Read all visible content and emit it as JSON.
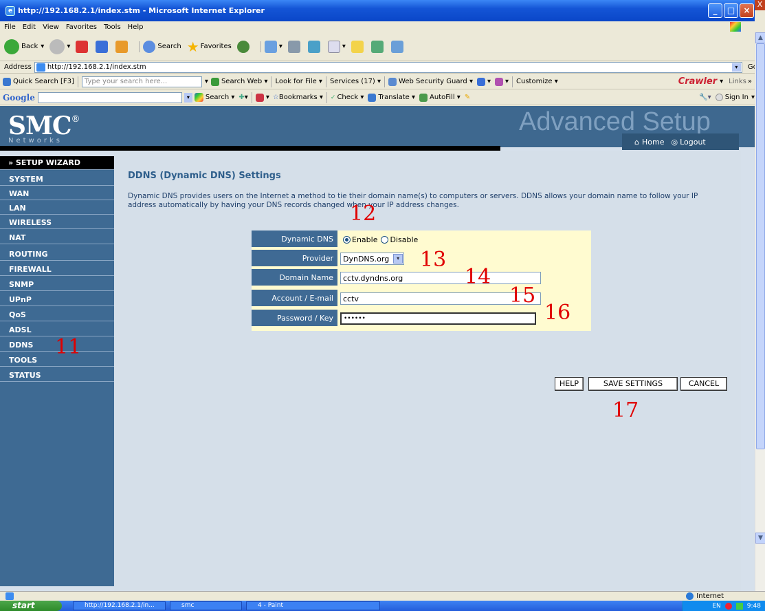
{
  "window": {
    "title": "http://192.168.2.1/index.stm - Microsoft Internet Explorer",
    "close_glyph": "X"
  },
  "menubar": [
    "File",
    "Edit",
    "View",
    "Favorites",
    "Tools",
    "Help"
  ],
  "toolbar": {
    "back": "Back",
    "search": "Search",
    "favorites": "Favorites"
  },
  "address": {
    "label": "Address",
    "url": "http://192.168.2.1/index.stm",
    "go": "Go"
  },
  "quicksearch": {
    "label": "Quick Search [F3]",
    "placeholder": "Type your search here...",
    "search_web": "Search Web",
    "look_for_file": "Look for File",
    "services": "Services (17)",
    "web_security_guard": "Web Security Guard",
    "customize": "Customize",
    "crawler": "Crawler",
    "links": "Links"
  },
  "googlebar": {
    "logo": "Google",
    "search": "Search",
    "bookmarks": "Bookmarks",
    "check": "Check",
    "translate": "Translate",
    "autofill": "AutoFill",
    "sign_in": "Sign In"
  },
  "router": {
    "logo": "SMC",
    "logo_mark": "®",
    "logo_sub": "Networks",
    "section_title": "Advanced Setup",
    "home": "Home",
    "logout": "Logout"
  },
  "sidebar": {
    "wizard": "» SETUP WIZARD",
    "items": [
      "SYSTEM",
      "WAN",
      "LAN",
      "WIRELESS",
      "NAT",
      "ROUTING",
      "FIREWALL",
      "SNMP",
      "UPnP",
      "QoS",
      "ADSL",
      "DDNS",
      "TOOLS",
      "STATUS"
    ]
  },
  "page": {
    "title": "DDNS (Dynamic DNS) Settings",
    "description": "Dynamic DNS provides users on the Internet a method to tie their domain name(s) to computers or servers. DDNS allows your domain name to follow your IP address automatically by having your DNS records changed when your IP address changes."
  },
  "form": {
    "dynamic_dns_label": "Dynamic DNS",
    "enable": "Enable",
    "disable": "Disable",
    "provider_label": "Provider",
    "provider_value": "DynDNS.org",
    "domain_label": "Domain Name",
    "domain_value": "cctv.dyndns.org",
    "account_label": "Account / E-mail",
    "account_value": "cctv",
    "password_label": "Password / Key",
    "password_value": "••••••"
  },
  "buttons": {
    "help": "HELP",
    "save": "SAVE SETTINGS",
    "cancel": "CANCEL"
  },
  "annotations": [
    "11",
    "12",
    "13",
    "14",
    "15",
    "16",
    "17"
  ],
  "statusbar": {
    "zone": "Internet"
  },
  "taskbar": {
    "start": "start",
    "tasks": [
      "http://192.168.2.1/in...",
      "smc",
      "4 - Paint"
    ],
    "lang": "EN",
    "time": "9:48"
  }
}
